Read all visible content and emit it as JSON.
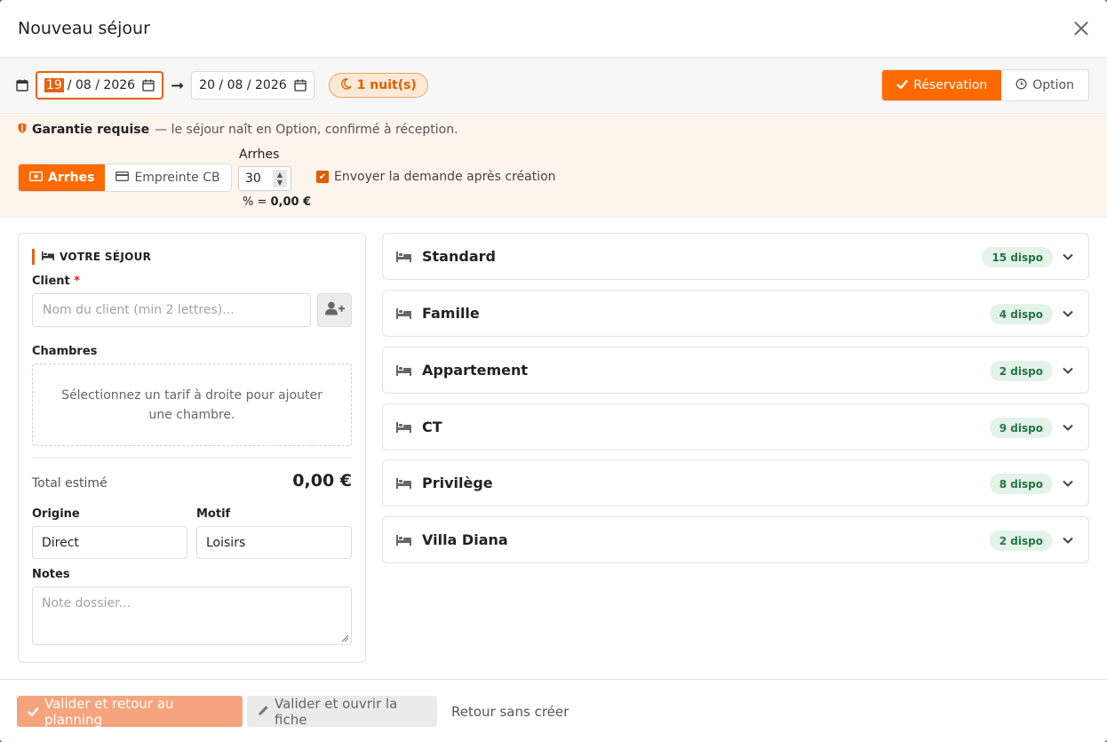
{
  "modal": {
    "title": "Nouveau séjour"
  },
  "dates": {
    "arrival_day": "19",
    "arrival_rest": "/ 08 / 2026",
    "departure": "20 / 08 / 2026",
    "nights": "1 nuit(s)"
  },
  "booking_type": {
    "reservation": "Réservation",
    "option": "Option",
    "selected": "Réservation"
  },
  "guarantee": {
    "title": "Garantie requise",
    "note": "— le séjour naît en Option, confirmé à réception.",
    "methods": [
      "Arrhes",
      "Empreinte CB"
    ],
    "selected_method": "Arrhes",
    "arrhes_label": "Arrhes",
    "arrhes_percent": "30",
    "arrhes_sum_prefix": "% = ",
    "arrhes_sum_value": "0,00 €",
    "send_request_label": "Envoyer la demande après création",
    "send_request_checked": true
  },
  "stay": {
    "section_title": "VOTRE SÉJOUR",
    "client_label": "Client",
    "required_mark": "*",
    "client_placeholder": "Nom du client (min 2 lettres)...",
    "rooms_label": "Chambres",
    "rooms_empty": "Sélectionnez un tarif à droite pour ajouter une chambre.",
    "total_label": "Total estimé",
    "total_value": "0,00 €",
    "origin_label": "Origine",
    "origin_value": "Direct",
    "motif_label": "Motif",
    "motif_value": "Loisirs",
    "notes_label": "Notes",
    "notes_placeholder": "Note dossier..."
  },
  "room_types": [
    {
      "name": "Standard",
      "dispo": "15 dispo"
    },
    {
      "name": "Famille",
      "dispo": "4 dispo"
    },
    {
      "name": "Appartement",
      "dispo": "2 dispo"
    },
    {
      "name": "CT",
      "dispo": "9 dispo"
    },
    {
      "name": "Privilège",
      "dispo": "8 dispo"
    },
    {
      "name": "Villa Diana",
      "dispo": "2 dispo"
    }
  ],
  "footer": {
    "validate_planning": "Valider et retour au planning",
    "validate_open": "Valider et ouvrir la fiche",
    "back_without_create": "Retour sans créer"
  },
  "colors": {
    "accent": "#ff6a00",
    "dispo_bg": "#e3f3e8",
    "dispo_text": "#27734a"
  },
  "icons": {
    "calendar": "calendar-icon",
    "moon": "moon-icon",
    "check": "check-icon",
    "clock": "clock-icon",
    "shield": "shield-icon",
    "money": "money-icon",
    "card": "credit-card-icon",
    "bed": "bed-icon",
    "add_user": "add-user-icon",
    "chevron": "chevron-down-icon",
    "pencil": "pencil-icon",
    "close": "close-icon"
  }
}
